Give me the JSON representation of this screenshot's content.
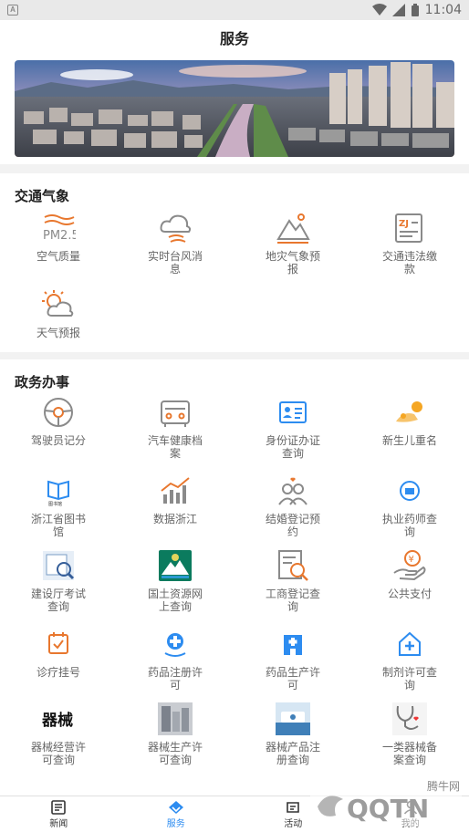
{
  "status_bar": {
    "time": "11:04"
  },
  "header": {
    "title": "服务"
  },
  "banner": {
    "alt": "city-river-banner"
  },
  "sections": [
    {
      "title": "交通气象",
      "items": [
        {
          "label": "空气质量",
          "icon": "air-quality-icon"
        },
        {
          "label": "实时台风消息",
          "icon": "typhoon-icon"
        },
        {
          "label": "地灾气象预报",
          "icon": "geo-hazard-icon"
        },
        {
          "label": "交通违法缴款",
          "icon": "traffic-fine-icon"
        },
        {
          "label": "天气预报",
          "icon": "weather-icon"
        }
      ]
    },
    {
      "title": "政务办事",
      "items": [
        {
          "label": "驾驶员记分",
          "icon": "steering-wheel-icon"
        },
        {
          "label": "汽车健康档案",
          "icon": "car-icon"
        },
        {
          "label": "身份证办证查询",
          "icon": "id-card-icon"
        },
        {
          "label": "新生儿重名",
          "icon": "baby-icon"
        },
        {
          "label": "浙江省图书馆",
          "icon": "library-icon"
        },
        {
          "label": "数据浙江",
          "icon": "bar-chart-icon"
        },
        {
          "label": "结婚登记预约",
          "icon": "marriage-icon"
        },
        {
          "label": "执业药师查询",
          "icon": "pharmacist-icon"
        },
        {
          "label": "建设厅考试查询",
          "icon": "exam-icon"
        },
        {
          "label": "国土资源网上查询",
          "icon": "land-resources-icon"
        },
        {
          "label": "工商登记查询",
          "icon": "business-search-icon"
        },
        {
          "label": "公共支付",
          "icon": "payment-icon"
        },
        {
          "label": "诊疗挂号",
          "icon": "calendar-check-icon"
        },
        {
          "label": "药品注册许可",
          "icon": "medicine-icon"
        },
        {
          "label": "药品生产许可",
          "icon": "hospital-icon"
        },
        {
          "label": "制剂许可查询",
          "icon": "house-plus-icon"
        },
        {
          "label": "器械经营许可查询",
          "icon": "device-trade-icon"
        },
        {
          "label": "器械生产许可查询",
          "icon": "device-production-icon"
        },
        {
          "label": "器械产品注册查询",
          "icon": "device-product-icon"
        },
        {
          "label": "一类器械备案查询",
          "icon": "stethoscope-icon"
        }
      ]
    }
  ],
  "tabs": [
    {
      "label": "新闻",
      "icon": "news-icon",
      "active": false
    },
    {
      "label": "服务",
      "icon": "service-icon",
      "active": true
    },
    {
      "label": "活动",
      "icon": "activity-icon",
      "active": false
    },
    {
      "label": "我的",
      "icon": "profile-icon",
      "active": false
    }
  ],
  "watermark": {
    "text": "腾牛网",
    "brand": "QQTN"
  },
  "colors": {
    "accent": "#2d8cf0",
    "icon_orange": "#e8772e",
    "icon_gray": "#8a8a8a"
  }
}
